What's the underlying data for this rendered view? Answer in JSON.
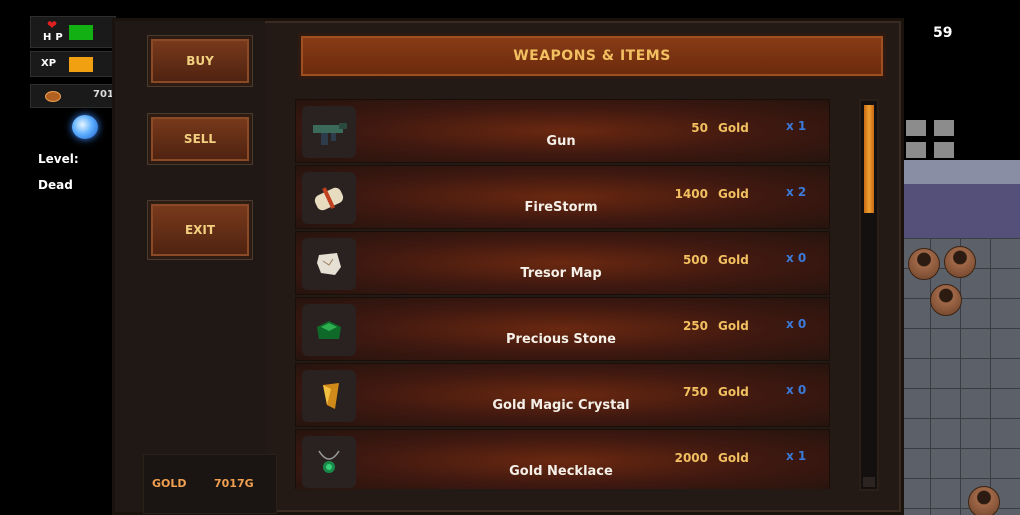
{
  "hud": {
    "hp_label": "HP",
    "hp_fraction": 0.55,
    "xp_label": "XP",
    "xp_fraction": 0.55,
    "gold_value": "701",
    "level_label": "Level:",
    "status_text": "Dead",
    "fps": "59"
  },
  "shop": {
    "title": "WEAPONS & ITEMS",
    "buttons": {
      "buy": "BUY",
      "sell": "SELL",
      "exit": "EXIT"
    },
    "gold_label": "GOLD",
    "gold_value": "7017G",
    "items": [
      {
        "name": "Gun",
        "price": "50",
        "currency": "Gold",
        "qty": "x 1",
        "icon": "gun-icon"
      },
      {
        "name": "FireStorm",
        "price": "1400",
        "currency": "Gold",
        "qty": "x 2",
        "icon": "scroll-icon"
      },
      {
        "name": "Tresor Map",
        "price": "500",
        "currency": "Gold",
        "qty": "x 0",
        "icon": "map-icon"
      },
      {
        "name": "Precious Stone",
        "price": "250",
        "currency": "Gold",
        "qty": "x 0",
        "icon": "gem-icon"
      },
      {
        "name": "Gold Magic Crystal",
        "price": "750",
        "currency": "Gold",
        "qty": "x 0",
        "icon": "crystal-icon"
      },
      {
        "name": "Gold Necklace",
        "price": "2000",
        "currency": "Gold",
        "qty": "x 1",
        "icon": "necklace-icon"
      }
    ],
    "scroll_position": 0
  },
  "colors": {
    "hp": "#12b012",
    "xp": "#f0a010",
    "accent_gold": "#f2c060",
    "qty_blue": "#3a7ad8"
  }
}
